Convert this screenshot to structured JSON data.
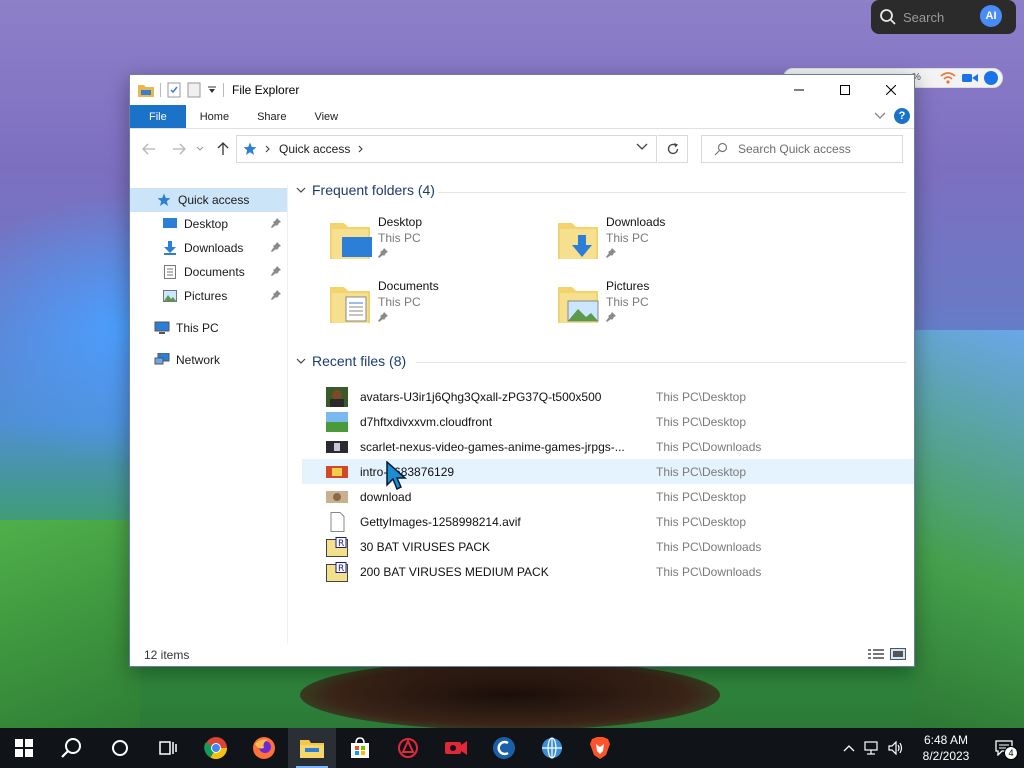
{
  "desktop": {
    "search_pill": {
      "placeholder": "Search",
      "ai_label": "AI"
    },
    "peek_bar": {
      "percent": "%"
    }
  },
  "window": {
    "title": "File Explorer",
    "ribbon_tabs": [
      "File",
      "Home",
      "Share",
      "View"
    ],
    "help_label": "?",
    "address": {
      "crumb": "Quick access"
    },
    "search": {
      "placeholder": "Search Quick access"
    }
  },
  "sidebar": {
    "quick_access": "Quick access",
    "pinned": [
      {
        "label": "Desktop",
        "icon": "desktop-icon"
      },
      {
        "label": "Downloads",
        "icon": "download-arrow-icon"
      },
      {
        "label": "Documents",
        "icon": "document-icon"
      },
      {
        "label": "Pictures",
        "icon": "pictures-icon"
      }
    ],
    "this_pc": "This PC",
    "network": "Network"
  },
  "frequent": {
    "header": "Frequent folders (4)",
    "folders": [
      {
        "name": "Desktop",
        "location": "This PC",
        "icon": "desktop-folder-icon"
      },
      {
        "name": "Downloads",
        "location": "This PC",
        "icon": "downloads-folder-icon"
      },
      {
        "name": "Documents",
        "location": "This PC",
        "icon": "documents-folder-icon"
      },
      {
        "name": "Pictures",
        "location": "This PC",
        "icon": "pictures-folder-icon"
      }
    ]
  },
  "recent": {
    "header": "Recent files (8)",
    "files": [
      {
        "name": "avatars-U3ir1j6Qhg3Qxall-zPG37Q-t500x500",
        "location": "This PC\\Desktop",
        "thumb": "photo"
      },
      {
        "name": "d7hftxdivxxvm.cloudfront",
        "location": "This PC\\Desktop",
        "thumb": "landscape"
      },
      {
        "name": "scarlet-nexus-video-games-anime-games-jrpgs-...",
        "location": "This PC\\Downloads",
        "thumb": "dark"
      },
      {
        "name": "intro-1683876129",
        "location": "This PC\\Desktop",
        "thumb": "colorful"
      },
      {
        "name": "download",
        "location": "This PC\\Desktop",
        "thumb": "cat"
      },
      {
        "name": "GettyImages-1258998214.avif",
        "location": "This PC\\Desktop",
        "thumb": "blank"
      },
      {
        "name": "30 BAT VIRUSES PACK",
        "location": "This PC\\Downloads",
        "thumb": "rar"
      },
      {
        "name": "200 BAT VIRUSES MEDIUM PACK",
        "location": "This PC\\Downloads",
        "thumb": "rar"
      }
    ]
  },
  "status": {
    "count": "12 items"
  },
  "taskbar": {
    "icons": [
      "windows-start-icon",
      "search-icon",
      "cortana-icon",
      "task-view-icon",
      "chrome-icon",
      "firefox-icon",
      "file-explorer-icon",
      "store-icon",
      "app-red-icon",
      "camera-app-icon",
      "ccleaner-icon",
      "app-globe-icon",
      "brave-icon"
    ],
    "time": "6:48 AM",
    "date": "8/2/2023",
    "notifications": "4"
  }
}
